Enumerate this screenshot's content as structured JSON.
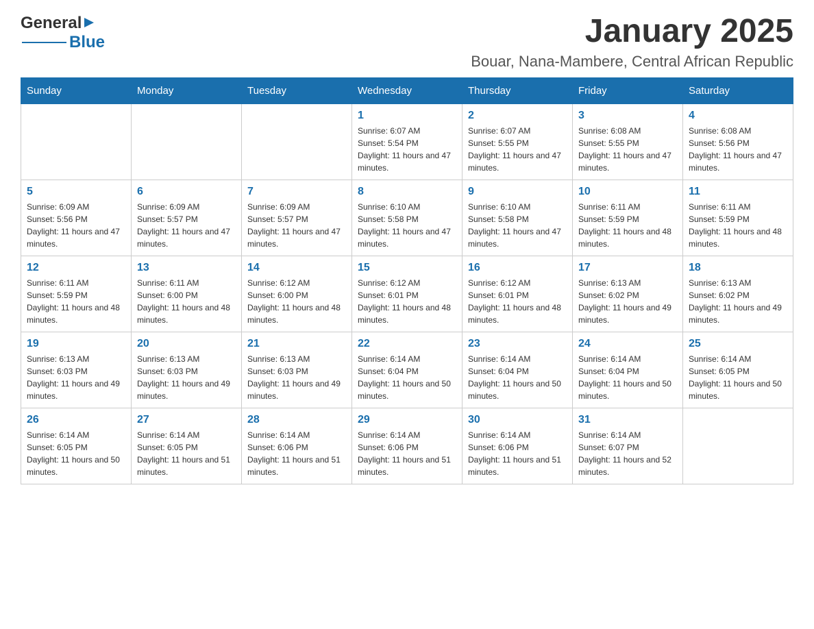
{
  "header": {
    "logo": {
      "general": "General",
      "triangle": "▶",
      "blue": "Blue"
    },
    "title": "January 2025",
    "location": "Bouar, Nana-Mambere, Central African Republic"
  },
  "calendar": {
    "days_of_week": [
      "Sunday",
      "Monday",
      "Tuesday",
      "Wednesday",
      "Thursday",
      "Friday",
      "Saturday"
    ],
    "weeks": [
      [
        {
          "day": "",
          "info": ""
        },
        {
          "day": "",
          "info": ""
        },
        {
          "day": "",
          "info": ""
        },
        {
          "day": "1",
          "info": "Sunrise: 6:07 AM\nSunset: 5:54 PM\nDaylight: 11 hours and 47 minutes."
        },
        {
          "day": "2",
          "info": "Sunrise: 6:07 AM\nSunset: 5:55 PM\nDaylight: 11 hours and 47 minutes."
        },
        {
          "day": "3",
          "info": "Sunrise: 6:08 AM\nSunset: 5:55 PM\nDaylight: 11 hours and 47 minutes."
        },
        {
          "day": "4",
          "info": "Sunrise: 6:08 AM\nSunset: 5:56 PM\nDaylight: 11 hours and 47 minutes."
        }
      ],
      [
        {
          "day": "5",
          "info": "Sunrise: 6:09 AM\nSunset: 5:56 PM\nDaylight: 11 hours and 47 minutes."
        },
        {
          "day": "6",
          "info": "Sunrise: 6:09 AM\nSunset: 5:57 PM\nDaylight: 11 hours and 47 minutes."
        },
        {
          "day": "7",
          "info": "Sunrise: 6:09 AM\nSunset: 5:57 PM\nDaylight: 11 hours and 47 minutes."
        },
        {
          "day": "8",
          "info": "Sunrise: 6:10 AM\nSunset: 5:58 PM\nDaylight: 11 hours and 47 minutes."
        },
        {
          "day": "9",
          "info": "Sunrise: 6:10 AM\nSunset: 5:58 PM\nDaylight: 11 hours and 47 minutes."
        },
        {
          "day": "10",
          "info": "Sunrise: 6:11 AM\nSunset: 5:59 PM\nDaylight: 11 hours and 48 minutes."
        },
        {
          "day": "11",
          "info": "Sunrise: 6:11 AM\nSunset: 5:59 PM\nDaylight: 11 hours and 48 minutes."
        }
      ],
      [
        {
          "day": "12",
          "info": "Sunrise: 6:11 AM\nSunset: 5:59 PM\nDaylight: 11 hours and 48 minutes."
        },
        {
          "day": "13",
          "info": "Sunrise: 6:11 AM\nSunset: 6:00 PM\nDaylight: 11 hours and 48 minutes."
        },
        {
          "day": "14",
          "info": "Sunrise: 6:12 AM\nSunset: 6:00 PM\nDaylight: 11 hours and 48 minutes."
        },
        {
          "day": "15",
          "info": "Sunrise: 6:12 AM\nSunset: 6:01 PM\nDaylight: 11 hours and 48 minutes."
        },
        {
          "day": "16",
          "info": "Sunrise: 6:12 AM\nSunset: 6:01 PM\nDaylight: 11 hours and 48 minutes."
        },
        {
          "day": "17",
          "info": "Sunrise: 6:13 AM\nSunset: 6:02 PM\nDaylight: 11 hours and 49 minutes."
        },
        {
          "day": "18",
          "info": "Sunrise: 6:13 AM\nSunset: 6:02 PM\nDaylight: 11 hours and 49 minutes."
        }
      ],
      [
        {
          "day": "19",
          "info": "Sunrise: 6:13 AM\nSunset: 6:03 PM\nDaylight: 11 hours and 49 minutes."
        },
        {
          "day": "20",
          "info": "Sunrise: 6:13 AM\nSunset: 6:03 PM\nDaylight: 11 hours and 49 minutes."
        },
        {
          "day": "21",
          "info": "Sunrise: 6:13 AM\nSunset: 6:03 PM\nDaylight: 11 hours and 49 minutes."
        },
        {
          "day": "22",
          "info": "Sunrise: 6:14 AM\nSunset: 6:04 PM\nDaylight: 11 hours and 50 minutes."
        },
        {
          "day": "23",
          "info": "Sunrise: 6:14 AM\nSunset: 6:04 PM\nDaylight: 11 hours and 50 minutes."
        },
        {
          "day": "24",
          "info": "Sunrise: 6:14 AM\nSunset: 6:04 PM\nDaylight: 11 hours and 50 minutes."
        },
        {
          "day": "25",
          "info": "Sunrise: 6:14 AM\nSunset: 6:05 PM\nDaylight: 11 hours and 50 minutes."
        }
      ],
      [
        {
          "day": "26",
          "info": "Sunrise: 6:14 AM\nSunset: 6:05 PM\nDaylight: 11 hours and 50 minutes."
        },
        {
          "day": "27",
          "info": "Sunrise: 6:14 AM\nSunset: 6:05 PM\nDaylight: 11 hours and 51 minutes."
        },
        {
          "day": "28",
          "info": "Sunrise: 6:14 AM\nSunset: 6:06 PM\nDaylight: 11 hours and 51 minutes."
        },
        {
          "day": "29",
          "info": "Sunrise: 6:14 AM\nSunset: 6:06 PM\nDaylight: 11 hours and 51 minutes."
        },
        {
          "day": "30",
          "info": "Sunrise: 6:14 AM\nSunset: 6:06 PM\nDaylight: 11 hours and 51 minutes."
        },
        {
          "day": "31",
          "info": "Sunrise: 6:14 AM\nSunset: 6:07 PM\nDaylight: 11 hours and 52 minutes."
        },
        {
          "day": "",
          "info": ""
        }
      ]
    ]
  }
}
